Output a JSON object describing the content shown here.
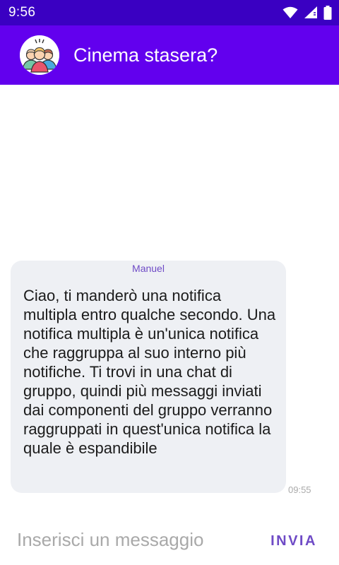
{
  "status_bar": {
    "time": "9:56",
    "icons": [
      "wifi-icon",
      "cellular-signal-icon",
      "battery-icon"
    ]
  },
  "app_bar": {
    "avatar_icon": "group-avatar-icon",
    "title": "Cinema stasera?",
    "background": "#6200ee"
  },
  "conversation": {
    "messages": [
      {
        "sender": "Manuel",
        "text": "Ciao, ti manderò una notifica multipla entro qualche secondo. Una notifica multipla è un'unica notifica che raggruppa al suo interno più notifiche. Ti trovi in una chat di gruppo, quindi più messaggi inviati dai componenti del gruppo verranno raggruppati in quest'unica notifica la quale è espandibile",
        "time": "09:55"
      }
    ]
  },
  "composer": {
    "placeholder": "Inserisci un messaggio",
    "value": "",
    "send_label": "INVIA"
  },
  "colors": {
    "status_bar": "#3a00c2",
    "primary": "#6200ee",
    "accent_text": "#6f4bc6",
    "bubble": "#eef0f4"
  }
}
